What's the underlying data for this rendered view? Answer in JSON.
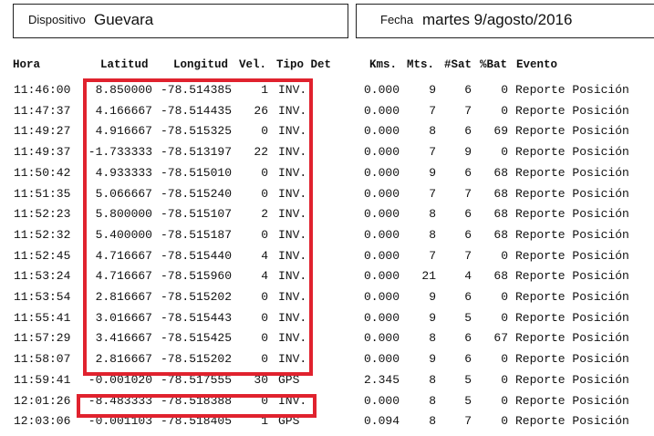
{
  "header": {
    "dispositivo_label": "Dispositivo",
    "dispositivo_value": "Guevara",
    "fecha_label": "Fecha",
    "fecha_value": "martes 9/agosto/2016"
  },
  "columns": {
    "hora": "Hora",
    "latitud": "Latitud",
    "longitud": "Longitud",
    "vel": "Vel.",
    "tipo_det": "Tipo Det",
    "kms": "Kms.",
    "mts": "Mts.",
    "sat": "#Sat",
    "bat": "%Bat",
    "evento": "Evento"
  },
  "rows": [
    {
      "hora": "11:46:00",
      "lat": "8.850000",
      "lon": "-78.514385",
      "vel": "1",
      "tipo": "INV.",
      "kms": "0.000",
      "mts": "9",
      "sat": "6",
      "bat": "0",
      "evento": "Reporte Posición"
    },
    {
      "hora": "11:47:37",
      "lat": "4.166667",
      "lon": "-78.514435",
      "vel": "26",
      "tipo": "INV.",
      "kms": "0.000",
      "mts": "7",
      "sat": "7",
      "bat": "0",
      "evento": "Reporte Posición"
    },
    {
      "hora": "11:49:27",
      "lat": "4.916667",
      "lon": "-78.515325",
      "vel": "0",
      "tipo": "INV.",
      "kms": "0.000",
      "mts": "8",
      "sat": "6",
      "bat": "69",
      "evento": "Reporte Posición"
    },
    {
      "hora": "11:49:37",
      "lat": "-1.733333",
      "lon": "-78.513197",
      "vel": "22",
      "tipo": "INV.",
      "kms": "0.000",
      "mts": "7",
      "sat": "9",
      "bat": "0",
      "evento": "Reporte Posición"
    },
    {
      "hora": "11:50:42",
      "lat": "4.933333",
      "lon": "-78.515010",
      "vel": "0",
      "tipo": "INV.",
      "kms": "0.000",
      "mts": "9",
      "sat": "6",
      "bat": "68",
      "evento": "Reporte Posición"
    },
    {
      "hora": "11:51:35",
      "lat": "5.066667",
      "lon": "-78.515240",
      "vel": "0",
      "tipo": "INV.",
      "kms": "0.000",
      "mts": "7",
      "sat": "7",
      "bat": "68",
      "evento": "Reporte Posición"
    },
    {
      "hora": "11:52:23",
      "lat": "5.800000",
      "lon": "-78.515107",
      "vel": "2",
      "tipo": "INV.",
      "kms": "0.000",
      "mts": "8",
      "sat": "6",
      "bat": "68",
      "evento": "Reporte Posición"
    },
    {
      "hora": "11:52:32",
      "lat": "5.400000",
      "lon": "-78.515187",
      "vel": "0",
      "tipo": "INV.",
      "kms": "0.000",
      "mts": "8",
      "sat": "6",
      "bat": "68",
      "evento": "Reporte Posición"
    },
    {
      "hora": "11:52:45",
      "lat": "4.716667",
      "lon": "-78.515440",
      "vel": "4",
      "tipo": "INV.",
      "kms": "0.000",
      "mts": "7",
      "sat": "7",
      "bat": "0",
      "evento": "Reporte Posición"
    },
    {
      "hora": "11:53:24",
      "lat": "4.716667",
      "lon": "-78.515960",
      "vel": "4",
      "tipo": "INV.",
      "kms": "0.000",
      "mts": "21",
      "sat": "4",
      "bat": "68",
      "evento": "Reporte Posición"
    },
    {
      "hora": "11:53:54",
      "lat": "2.816667",
      "lon": "-78.515202",
      "vel": "0",
      "tipo": "INV.",
      "kms": "0.000",
      "mts": "9",
      "sat": "6",
      "bat": "0",
      "evento": "Reporte Posición"
    },
    {
      "hora": "11:55:41",
      "lat": "3.016667",
      "lon": "-78.515443",
      "vel": "0",
      "tipo": "INV.",
      "kms": "0.000",
      "mts": "9",
      "sat": "5",
      "bat": "0",
      "evento": "Reporte Posición"
    },
    {
      "hora": "11:57:29",
      "lat": "3.416667",
      "lon": "-78.515425",
      "vel": "0",
      "tipo": "INV.",
      "kms": "0.000",
      "mts": "8",
      "sat": "6",
      "bat": "67",
      "evento": "Reporte Posición"
    },
    {
      "hora": "11:58:07",
      "lat": "2.816667",
      "lon": "-78.515202",
      "vel": "0",
      "tipo": "INV.",
      "kms": "0.000",
      "mts": "9",
      "sat": "6",
      "bat": "0",
      "evento": "Reporte Posición"
    },
    {
      "hora": "11:59:41",
      "lat": "-0.001020",
      "lon": "-78.517555",
      "vel": "30",
      "tipo": "GPS",
      "kms": "2.345",
      "mts": "8",
      "sat": "5",
      "bat": "0",
      "evento": "Reporte Posición"
    },
    {
      "hora": "12:01:26",
      "lat": "-8.483333",
      "lon": "-78.518388",
      "vel": "0",
      "tipo": "INV.",
      "kms": "0.000",
      "mts": "8",
      "sat": "5",
      "bat": "0",
      "evento": "Reporte Posición"
    },
    {
      "hora": "12:03:06",
      "lat": "-0.001103",
      "lon": "-78.518405",
      "vel": "1",
      "tipo": "GPS",
      "kms": "0.094",
      "mts": "8",
      "sat": "7",
      "bat": "0",
      "evento": "Reporte Posición"
    }
  ],
  "highlight_color": "#e0222e"
}
